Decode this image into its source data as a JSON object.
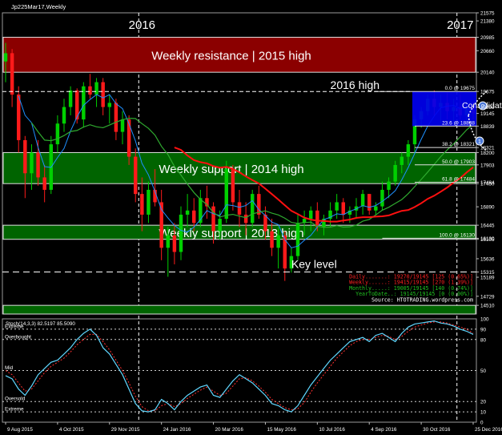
{
  "window": {
    "title": "Jp225Mar17,Weekly"
  },
  "chart_data": [
    {
      "type": "candlestick",
      "symbol": "Jp225Mar17",
      "timeframe": "Weekly",
      "ylim": [
        14300,
        21575
      ],
      "y_ticks": [
        21575,
        21380,
        20985,
        20660,
        20140,
        19675,
        19299,
        19145,
        18839,
        18321,
        18200,
        17903,
        17484,
        17450,
        16890,
        16445,
        16130,
        16105,
        15636,
        15315,
        15189,
        14729,
        14510
      ],
      "x_labels": [
        "9 Aug 2015",
        "4 Oct 2015",
        "29 Nov 2015",
        "24 Jan 2016",
        "20 Mar 2016",
        "15 May 2016",
        "10 Jul 2016",
        "4 Sep 2016",
        "30 Oct 2016",
        "25 Dec 2016"
      ],
      "year_labels": [
        {
          "text": "2016",
          "x_index": 21
        },
        {
          "text": "2017",
          "x_index": 70
        }
      ],
      "year_separators": [
        20.5,
        69.5
      ],
      "candles": [
        [
          20400,
          20850,
          19900,
          20600
        ],
        [
          20600,
          20700,
          19300,
          19600
        ],
        [
          19600,
          19800,
          18200,
          18500
        ],
        [
          18500,
          18600,
          17100,
          17700
        ],
        [
          17700,
          18400,
          17300,
          18200
        ],
        [
          18200,
          18500,
          17400,
          17600
        ],
        [
          17600,
          17900,
          17000,
          17300
        ],
        [
          17300,
          18600,
          17200,
          18400
        ],
        [
          18400,
          19100,
          18200,
          18900
        ],
        [
          18900,
          19500,
          18700,
          19300
        ],
        [
          19300,
          19800,
          19100,
          19700
        ],
        [
          19700,
          19750,
          18900,
          19000
        ],
        [
          19000,
          19900,
          18800,
          19800
        ],
        [
          19800,
          20100,
          19500,
          19600
        ],
        [
          19600,
          20000,
          19300,
          19900
        ],
        [
          19900,
          20000,
          19100,
          19300
        ],
        [
          19300,
          19600,
          18900,
          19400
        ],
        [
          19400,
          19500,
          18500,
          18700
        ],
        [
          18700,
          19200,
          18400,
          19000
        ],
        [
          19000,
          19100,
          17900,
          18100
        ],
        [
          18100,
          18300,
          17000,
          17200
        ],
        [
          17200,
          17600,
          16300,
          16700
        ],
        [
          16700,
          17500,
          16500,
          17300
        ],
        [
          17300,
          17800,
          16900,
          17000
        ],
        [
          17000,
          17300,
          15600,
          15900
        ],
        [
          15900,
          16400,
          15200,
          16200
        ],
        [
          16200,
          16500,
          15500,
          15800
        ],
        [
          15800,
          16900,
          15600,
          16700
        ],
        [
          16700,
          17200,
          16400,
          16800
        ],
        [
          16800,
          17100,
          16300,
          16500
        ],
        [
          16500,
          17300,
          16400,
          17100
        ],
        [
          17100,
          17400,
          16600,
          16900
        ],
        [
          16900,
          17000,
          16000,
          16300
        ],
        [
          16300,
          16800,
          16100,
          16600
        ],
        [
          16600,
          18000,
          16500,
          17800
        ],
        [
          17800,
          17900,
          16800,
          17000
        ],
        [
          17000,
          17300,
          16400,
          16700
        ],
        [
          16700,
          17000,
          16200,
          16500
        ],
        [
          16500,
          17300,
          16400,
          17200
        ],
        [
          17200,
          17400,
          16600,
          16700
        ],
        [
          16700,
          16900,
          16100,
          16300
        ],
        [
          16300,
          16600,
          15700,
          15900
        ],
        [
          15900,
          16400,
          15400,
          16200
        ],
        [
          16200,
          16300,
          15100,
          15400
        ],
        [
          15400,
          15900,
          15300,
          15700
        ],
        [
          15700,
          16700,
          15600,
          16500
        ],
        [
          16500,
          16800,
          16200,
          16600
        ],
        [
          16600,
          16900,
          16300,
          16800
        ],
        [
          16800,
          17000,
          16300,
          16400
        ],
        [
          16400,
          16700,
          16200,
          16600
        ],
        [
          16600,
          17000,
          16400,
          16800
        ],
        [
          16800,
          17200,
          16600,
          17000
        ],
        [
          17000,
          17100,
          16500,
          16700
        ],
        [
          16700,
          16900,
          16500,
          16800
        ],
        [
          16800,
          17100,
          16600,
          16900
        ],
        [
          16900,
          17300,
          16700,
          17200
        ],
        [
          17200,
          17200,
          16700,
          16800
        ],
        [
          16800,
          17000,
          16700,
          16900
        ],
        [
          16900,
          17500,
          16800,
          17300
        ],
        [
          17300,
          17600,
          17100,
          17500
        ],
        [
          17500,
          18000,
          17400,
          17900
        ],
        [
          17900,
          18200,
          17700,
          18100
        ],
        [
          18100,
          18500,
          17900,
          18400
        ],
        [
          18400,
          19100,
          18200,
          19000
        ],
        [
          19000,
          19300,
          18800,
          19200
        ],
        [
          19200,
          19600,
          19100,
          19500
        ],
        [
          19500,
          19700,
          19100,
          19300
        ],
        [
          19300,
          19600,
          18900,
          19400
        ],
        [
          19400,
          19650,
          19000,
          19200
        ],
        [
          19200,
          19500,
          18900,
          19300
        ],
        [
          19300,
          19600,
          19000,
          19100
        ],
        [
          19100,
          19450,
          18950,
          19300
        ],
        [
          19300,
          19400,
          19000,
          19145
        ]
      ],
      "series": [
        {
          "name": "",
          "color": "#1e90ff"
        },
        {
          "name": "",
          "color": "#2faa2f"
        },
        {
          "name": "",
          "color": "#ff1010"
        }
      ],
      "zones": [
        {
          "label": "Weekly resistance | 2015 high",
          "from": 20140,
          "to": 20985,
          "color": "#8b0000"
        },
        {
          "label": "Weekly support | 2014 high",
          "from": 17450,
          "to": 18200,
          "color": "#006400"
        },
        {
          "label": "Weekly support | 2013 high",
          "from": 16105,
          "to": 16445,
          "color": "#006400"
        },
        {
          "label": "",
          "from": 14300,
          "to": 14510,
          "color": "#006400"
        }
      ],
      "consolidation": {
        "label": "Consolidation zone",
        "from": 18839,
        "to": 19675,
        "start_index": 63
      },
      "key_level": {
        "label": "Key level",
        "value": 15315
      },
      "high_2016": {
        "label": "2016 high",
        "value": 19675
      },
      "fib_levels": [
        {
          "label": "0.0 @ 19675",
          "value": 19675
        },
        {
          "label": "23.6 @ 18838",
          "value": 18839
        },
        {
          "label": "38.2 @ 18321",
          "value": 18321
        },
        {
          "label": "50.0 @ 17903",
          "value": 17903
        },
        {
          "label": "61.8 @ 17484",
          "value": 17484
        },
        {
          "label": "100.0 @ 16130",
          "value": 16130
        }
      ],
      "annotations": {
        "arrow1_label": "1",
        "arrow2_label": "2",
        "info": [
          {
            "text": "Daily.......: 19270/19145  [125 (0.65%)]",
            "color": "#ff2020"
          },
          {
            "text": "Weekly......: 19415/19145  [270 (1.39%)]",
            "color": "#ff2020"
          },
          {
            "text": "Monthly.....: 19005/19145  [140 (0.74%)]",
            "color": "#20c020"
          },
          {
            "text": "YearToDate..: 19145/19145  [0 (0.00%)]",
            "color": "#20c020"
          },
          {
            "text": "Source: HTOTRADING.wordpress.com",
            "color": "#ffffff"
          }
        ]
      }
    },
    {
      "type": "line",
      "indicator": "Stoch(14,3,3)",
      "header": "Stoch(14,3,3) 82.5197 85.5090",
      "ylim": [
        0,
        100
      ],
      "levels": [
        {
          "label": "Extreme",
          "value": 90
        },
        {
          "label": "Overbought",
          "value": 80
        },
        {
          "label": "Mid",
          "value": 50
        },
        {
          "label": "Oversold",
          "value": 20
        },
        {
          "label": "Extreme",
          "value": 10
        }
      ],
      "y_ticks": [
        100,
        90,
        80,
        50,
        20,
        10,
        0
      ],
      "main_color": "#5fd7ff",
      "signal_color": "#ff3030",
      "main": [
        45,
        42,
        32,
        26,
        35,
        46,
        52,
        58,
        60,
        66,
        72,
        80,
        86,
        90,
        84,
        72,
        66,
        56,
        46,
        32,
        18,
        11,
        10,
        12,
        22,
        18,
        12,
        20,
        26,
        30,
        34,
        36,
        26,
        24,
        32,
        40,
        46,
        42,
        38,
        32,
        26,
        18,
        16,
        12,
        10,
        16,
        26,
        36,
        44,
        52,
        60,
        66,
        72,
        78,
        80,
        82,
        78,
        84,
        86,
        82,
        78,
        86,
        92,
        95,
        96,
        97,
        98,
        96,
        95,
        93,
        90,
        88,
        85
      ],
      "signal": [
        50,
        46,
        38,
        30,
        32,
        40,
        48,
        54,
        58,
        62,
        68,
        75,
        80,
        85,
        85,
        78,
        70,
        60,
        50,
        38,
        25,
        15,
        11,
        11,
        16,
        18,
        15,
        18,
        23,
        27,
        31,
        34,
        30,
        26,
        28,
        35,
        42,
        43,
        40,
        35,
        29,
        22,
        18,
        14,
        12,
        13,
        19,
        29,
        38,
        46,
        54,
        62,
        68,
        74,
        78,
        80,
        80,
        82,
        84,
        83,
        80,
        83,
        88,
        92,
        94,
        96,
        97,
        97,
        96,
        94,
        92,
        90,
        86
      ]
    }
  ]
}
